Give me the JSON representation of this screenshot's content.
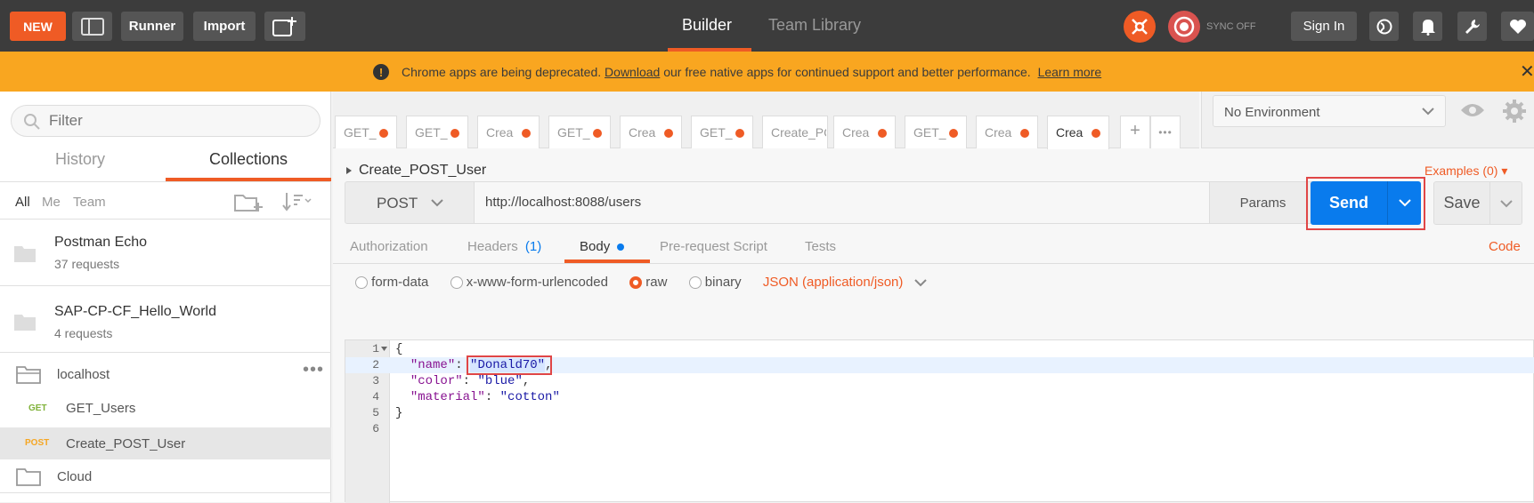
{
  "topbar": {
    "new_label": "NEW",
    "runner_label": "Runner",
    "import_label": "Import",
    "builder_label": "Builder",
    "team_library_label": "Team Library",
    "sync_label": "SYNC OFF",
    "sign_in_label": "Sign In"
  },
  "banner": {
    "text_before": "Chrome apps are being deprecated.",
    "download_link": "Download",
    "text_after": "our free native apps for continued support and better performance.",
    "learn_more": "Learn more"
  },
  "sidebar": {
    "filter_placeholder": "Filter",
    "tab_history": "History",
    "tab_collections": "Collections",
    "filter_all": "All",
    "filter_me": "Me",
    "filter_team": "Team",
    "collections": [
      {
        "name": "Postman Echo",
        "count": "37 requests"
      },
      {
        "name": "SAP-CP-CF_Hello_World",
        "count": "4 requests"
      }
    ],
    "folder_localhost": "localhost",
    "requests": [
      {
        "method": "GET",
        "name": "GET_Users"
      },
      {
        "method": "POST",
        "name": "Create_POST_User"
      }
    ],
    "folder_cloud": "Cloud"
  },
  "request_tabs": [
    "GET_",
    "GET_",
    "Crea",
    "GET_",
    "Crea",
    "GET_",
    "Create_PC",
    "Crea",
    "GET_",
    "Crea",
    "Crea"
  ],
  "environment": {
    "selected": "No Environment"
  },
  "request": {
    "name": "Create_POST_User",
    "examples": "Examples (0)",
    "method": "POST",
    "url": "http://localhost:8088/users",
    "params_label": "Params",
    "send_label": "Send",
    "save_label": "Save"
  },
  "subtabs": {
    "authorization": "Authorization",
    "headers": "Headers",
    "headers_count": "(1)",
    "body": "Body",
    "prerequest": "Pre-request Script",
    "tests": "Tests",
    "code": "Code"
  },
  "body_options": {
    "form_data": "form-data",
    "urlencoded": "x-www-form-urlencoded",
    "raw": "raw",
    "binary": "binary",
    "content_type": "JSON (application/json)"
  },
  "editor": {
    "line_numbers": [
      "1",
      "2",
      "3",
      "4",
      "5",
      "6"
    ],
    "open_brace": "{",
    "close_brace": "}",
    "name_key": "\"name\"",
    "name_value": "\"Donald70\"",
    "color_key": "\"color\"",
    "color_value": "\"blue\"",
    "material_key": "\"material\"",
    "material_value": "\"cotton\""
  }
}
